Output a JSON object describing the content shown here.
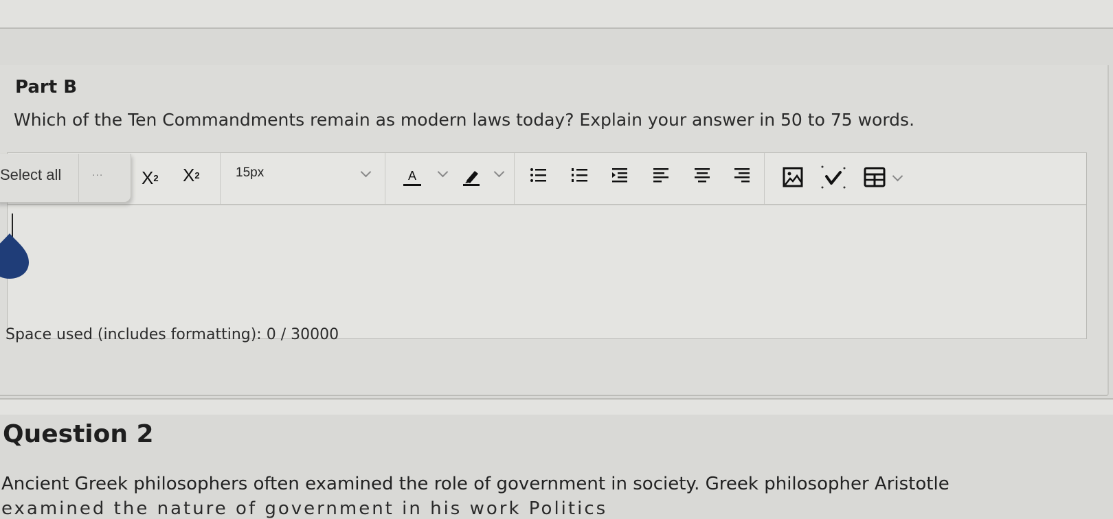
{
  "part_b": {
    "title": "Part B",
    "question": "Which of the Ten Commandments remain as modern laws today? Explain your answer in 50 to 75 words."
  },
  "selection_popup": {
    "select_all_label": "Select all",
    "more_label": "..."
  },
  "toolbar": {
    "superscript_base": "X",
    "superscript_exp": "2",
    "subscript_base": "X",
    "subscript_idx": "2",
    "font_size_value": "15px",
    "icons": [
      "text-color-icon",
      "highlight-color-icon",
      "bulleted-list-icon",
      "numbered-list-icon",
      "indent-icon",
      "align-left-icon",
      "align-center-icon",
      "align-right-icon",
      "insert-image-icon",
      "math-equation-icon",
      "insert-table-icon"
    ],
    "text_color_letter": "A"
  },
  "editor": {
    "value": "",
    "space_used_label": "Space used (includes formatting): 0 / 30000",
    "caret_handle_color": "#1f3d78"
  },
  "question_2": {
    "title": "Question 2",
    "text_line_1": "Ancient Greek philosophers often examined the role of government in society. Greek philosopher Aristotle",
    "text_line_2": "examined the nature of government in his work Politics"
  }
}
